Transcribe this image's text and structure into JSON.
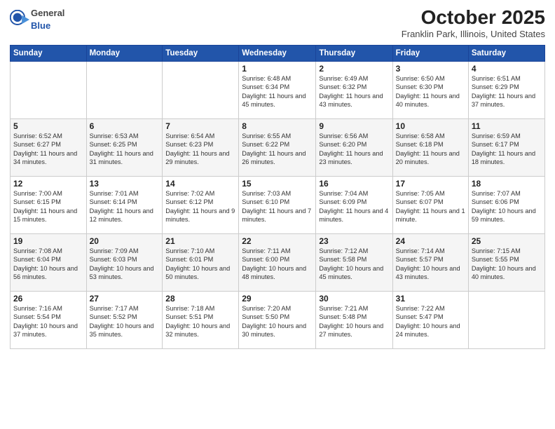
{
  "header": {
    "logo_general": "General",
    "logo_blue": "Blue",
    "month": "October 2025",
    "location": "Franklin Park, Illinois, United States"
  },
  "weekdays": [
    "Sunday",
    "Monday",
    "Tuesday",
    "Wednesday",
    "Thursday",
    "Friday",
    "Saturday"
  ],
  "weeks": [
    [
      {
        "day": "",
        "info": ""
      },
      {
        "day": "",
        "info": ""
      },
      {
        "day": "",
        "info": ""
      },
      {
        "day": "1",
        "info": "Sunrise: 6:48 AM\nSunset: 6:34 PM\nDaylight: 11 hours and 45 minutes."
      },
      {
        "day": "2",
        "info": "Sunrise: 6:49 AM\nSunset: 6:32 PM\nDaylight: 11 hours and 43 minutes."
      },
      {
        "day": "3",
        "info": "Sunrise: 6:50 AM\nSunset: 6:30 PM\nDaylight: 11 hours and 40 minutes."
      },
      {
        "day": "4",
        "info": "Sunrise: 6:51 AM\nSunset: 6:29 PM\nDaylight: 11 hours and 37 minutes."
      }
    ],
    [
      {
        "day": "5",
        "info": "Sunrise: 6:52 AM\nSunset: 6:27 PM\nDaylight: 11 hours and 34 minutes."
      },
      {
        "day": "6",
        "info": "Sunrise: 6:53 AM\nSunset: 6:25 PM\nDaylight: 11 hours and 31 minutes."
      },
      {
        "day": "7",
        "info": "Sunrise: 6:54 AM\nSunset: 6:23 PM\nDaylight: 11 hours and 29 minutes."
      },
      {
        "day": "8",
        "info": "Sunrise: 6:55 AM\nSunset: 6:22 PM\nDaylight: 11 hours and 26 minutes."
      },
      {
        "day": "9",
        "info": "Sunrise: 6:56 AM\nSunset: 6:20 PM\nDaylight: 11 hours and 23 minutes."
      },
      {
        "day": "10",
        "info": "Sunrise: 6:58 AM\nSunset: 6:18 PM\nDaylight: 11 hours and 20 minutes."
      },
      {
        "day": "11",
        "info": "Sunrise: 6:59 AM\nSunset: 6:17 PM\nDaylight: 11 hours and 18 minutes."
      }
    ],
    [
      {
        "day": "12",
        "info": "Sunrise: 7:00 AM\nSunset: 6:15 PM\nDaylight: 11 hours and 15 minutes."
      },
      {
        "day": "13",
        "info": "Sunrise: 7:01 AM\nSunset: 6:14 PM\nDaylight: 11 hours and 12 minutes."
      },
      {
        "day": "14",
        "info": "Sunrise: 7:02 AM\nSunset: 6:12 PM\nDaylight: 11 hours and 9 minutes."
      },
      {
        "day": "15",
        "info": "Sunrise: 7:03 AM\nSunset: 6:10 PM\nDaylight: 11 hours and 7 minutes."
      },
      {
        "day": "16",
        "info": "Sunrise: 7:04 AM\nSunset: 6:09 PM\nDaylight: 11 hours and 4 minutes."
      },
      {
        "day": "17",
        "info": "Sunrise: 7:05 AM\nSunset: 6:07 PM\nDaylight: 11 hours and 1 minute."
      },
      {
        "day": "18",
        "info": "Sunrise: 7:07 AM\nSunset: 6:06 PM\nDaylight: 10 hours and 59 minutes."
      }
    ],
    [
      {
        "day": "19",
        "info": "Sunrise: 7:08 AM\nSunset: 6:04 PM\nDaylight: 10 hours and 56 minutes."
      },
      {
        "day": "20",
        "info": "Sunrise: 7:09 AM\nSunset: 6:03 PM\nDaylight: 10 hours and 53 minutes."
      },
      {
        "day": "21",
        "info": "Sunrise: 7:10 AM\nSunset: 6:01 PM\nDaylight: 10 hours and 50 minutes."
      },
      {
        "day": "22",
        "info": "Sunrise: 7:11 AM\nSunset: 6:00 PM\nDaylight: 10 hours and 48 minutes."
      },
      {
        "day": "23",
        "info": "Sunrise: 7:12 AM\nSunset: 5:58 PM\nDaylight: 10 hours and 45 minutes."
      },
      {
        "day": "24",
        "info": "Sunrise: 7:14 AM\nSunset: 5:57 PM\nDaylight: 10 hours and 43 minutes."
      },
      {
        "day": "25",
        "info": "Sunrise: 7:15 AM\nSunset: 5:55 PM\nDaylight: 10 hours and 40 minutes."
      }
    ],
    [
      {
        "day": "26",
        "info": "Sunrise: 7:16 AM\nSunset: 5:54 PM\nDaylight: 10 hours and 37 minutes."
      },
      {
        "day": "27",
        "info": "Sunrise: 7:17 AM\nSunset: 5:52 PM\nDaylight: 10 hours and 35 minutes."
      },
      {
        "day": "28",
        "info": "Sunrise: 7:18 AM\nSunset: 5:51 PM\nDaylight: 10 hours and 32 minutes."
      },
      {
        "day": "29",
        "info": "Sunrise: 7:20 AM\nSunset: 5:50 PM\nDaylight: 10 hours and 30 minutes."
      },
      {
        "day": "30",
        "info": "Sunrise: 7:21 AM\nSunset: 5:48 PM\nDaylight: 10 hours and 27 minutes."
      },
      {
        "day": "31",
        "info": "Sunrise: 7:22 AM\nSunset: 5:47 PM\nDaylight: 10 hours and 24 minutes."
      },
      {
        "day": "",
        "info": ""
      }
    ]
  ]
}
